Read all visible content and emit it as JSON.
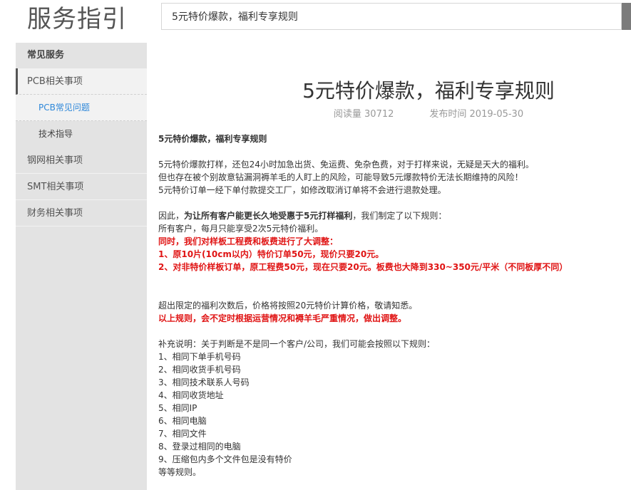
{
  "header": {
    "brand": "服务指引",
    "search_value": "5元特价爆款，福利专享规则"
  },
  "sidebar": {
    "heading": "常见服务",
    "items": [
      {
        "label": "PCB相关事项"
      },
      {
        "label": "PCB常见问题"
      },
      {
        "label": "技术指导"
      },
      {
        "label": "钢网相关事项"
      },
      {
        "label": "SMT相关事项"
      },
      {
        "label": "财务相关事项"
      }
    ]
  },
  "article": {
    "title": "5元特价爆款，福利专享规则",
    "reads": "阅读量 30712",
    "published": "发布时间 2019-05-30",
    "lines": [
      "5元特价爆款，福利专享规则",
      "5元特价爆款打样，还包24小时加急出货、免运费、免杂色费，对于打样来说，无疑是天大的福利。",
      "但也存在被个别故意钻漏洞褥羊毛的人盯上的风险，可能导致5元爆款特价无法长期维持的风险！",
      "5元特价订单一经下单付款提交工厂，如修改取消订单将不会进行退款处理。",
      "因此，",
      "为让所有客户能更长久地受惠于5元打样福利",
      "，我们制定了以下规则：",
      "所有客户，每月只能享受2次5元特价福利。",
      "同时，我们对样板工程费和板费进行了大调整：",
      "1、原10片(10cm以内）特价订单50元，现价只要20元。",
      "2、对非特价样板订单，原工程费50元，现在只要20元。板费也大降到330~350元/平米（不同板厚不同）",
      "超出限定的福利次数后，价格将按照20元特价计算价格，敬请知悉。",
      "以上规则，会不定时根据运营情况和褥羊毛严重情况，做出调整。",
      "补充说明：关于判断是不是同一个客户/公司，我们可能会按照以下规则：",
      "1、相同下单手机号码",
      "2、相同收货手机号码",
      "3、相同技术联系人号码",
      "4、相同收货地址",
      "5、相同IP",
      "6、相同电脑",
      "7、相同文件",
      "8、登录过相同的电脑",
      "9、压缩包内多个文件包是没有特价",
      "等等规则。"
    ]
  },
  "colors": {
    "sidebar_bg": "#e3e3e3",
    "active_link": "#2d87d9",
    "highlight_red": "#e01414"
  }
}
